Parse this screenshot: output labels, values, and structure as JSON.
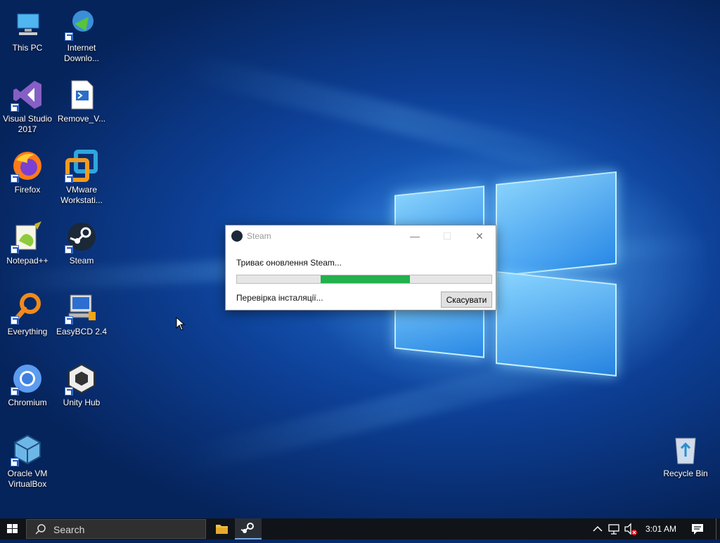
{
  "desktop": {
    "icons": [
      {
        "label": "This PC"
      },
      {
        "label": "Internet Downlo..."
      },
      {
        "label": "Visual Studio 2017"
      },
      {
        "label": "Remove_V..."
      },
      {
        "label": "Firefox"
      },
      {
        "label": "VMware Workstati..."
      },
      {
        "label": "Notepad++"
      },
      {
        "label": "Steam"
      },
      {
        "label": "Everything"
      },
      {
        "label": "EasyBCD 2.4"
      },
      {
        "label": "Chromium"
      },
      {
        "label": "Unity Hub"
      },
      {
        "label": "Oracle VM VirtualBox"
      },
      {
        "label": "Recycle Bin"
      }
    ]
  },
  "dialog": {
    "title": "Steam",
    "message": "Триває оновлення Steam...",
    "progress": 0.35,
    "status": "Перевірка інсталяції...",
    "cancel_label": "Скасувати"
  },
  "taskbar": {
    "search_placeholder": "Search",
    "clock": "3:01 AM"
  },
  "colors": {
    "progress_fill": "#22b14c",
    "taskbar_bg": "#101418"
  }
}
